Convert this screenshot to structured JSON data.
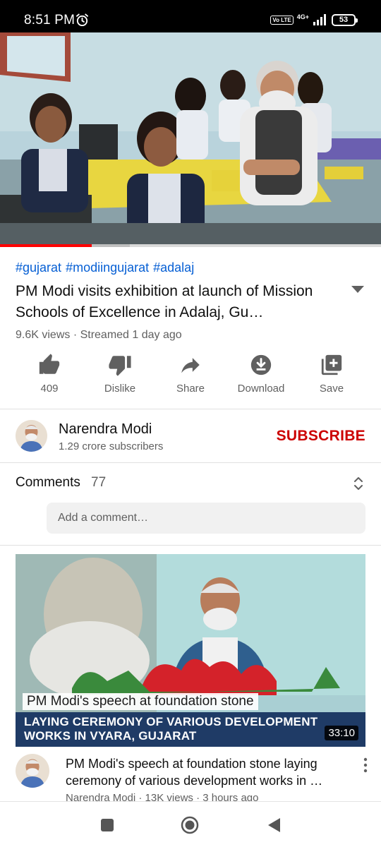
{
  "status_bar": {
    "time": "8:51 PM",
    "volte": "Vo LTE",
    "network": "4G+",
    "battery": "53"
  },
  "video": {
    "progress_percent": 24,
    "buffer_percent": 34
  },
  "hashtags": [
    "#gujarat",
    "#modiingujarat",
    "#adalaj"
  ],
  "title": "PM Modi visits exhibition at launch of Mission Schools of Excellence in Adalaj, Gu…",
  "meta": "9.6K views · Streamed 1 day ago",
  "actions": [
    {
      "label": "409",
      "icon": "thumbs-up-icon"
    },
    {
      "label": "Dislike",
      "icon": "thumbs-down-icon"
    },
    {
      "label": "Share",
      "icon": "share-icon"
    },
    {
      "label": "Download",
      "icon": "download-icon"
    },
    {
      "label": "Save",
      "icon": "save-playlist-icon"
    }
  ],
  "channel": {
    "name": "Narendra Modi",
    "subscribers": "1.29 crore subscribers",
    "subscribe_label": "SUBSCRIBE"
  },
  "comments": {
    "label": "Comments",
    "count": "77",
    "placeholder": "Add a comment…"
  },
  "recommended": {
    "thumb_caption_1": "PM Modi's speech at foundation stone",
    "thumb_caption_2": "LAYING CEREMONY OF VARIOUS DEVELOPMENT WORKS IN VYARA, GUJARAT",
    "duration": "33:10",
    "title": "PM Modi's speech at foundation stone laying ceremony of various development works in …",
    "meta": "Narendra Modi · 13K views · 3 hours ago"
  },
  "colors": {
    "link": "#065fd4",
    "subscribe": "#cc0000",
    "progress": "#ff0000"
  }
}
